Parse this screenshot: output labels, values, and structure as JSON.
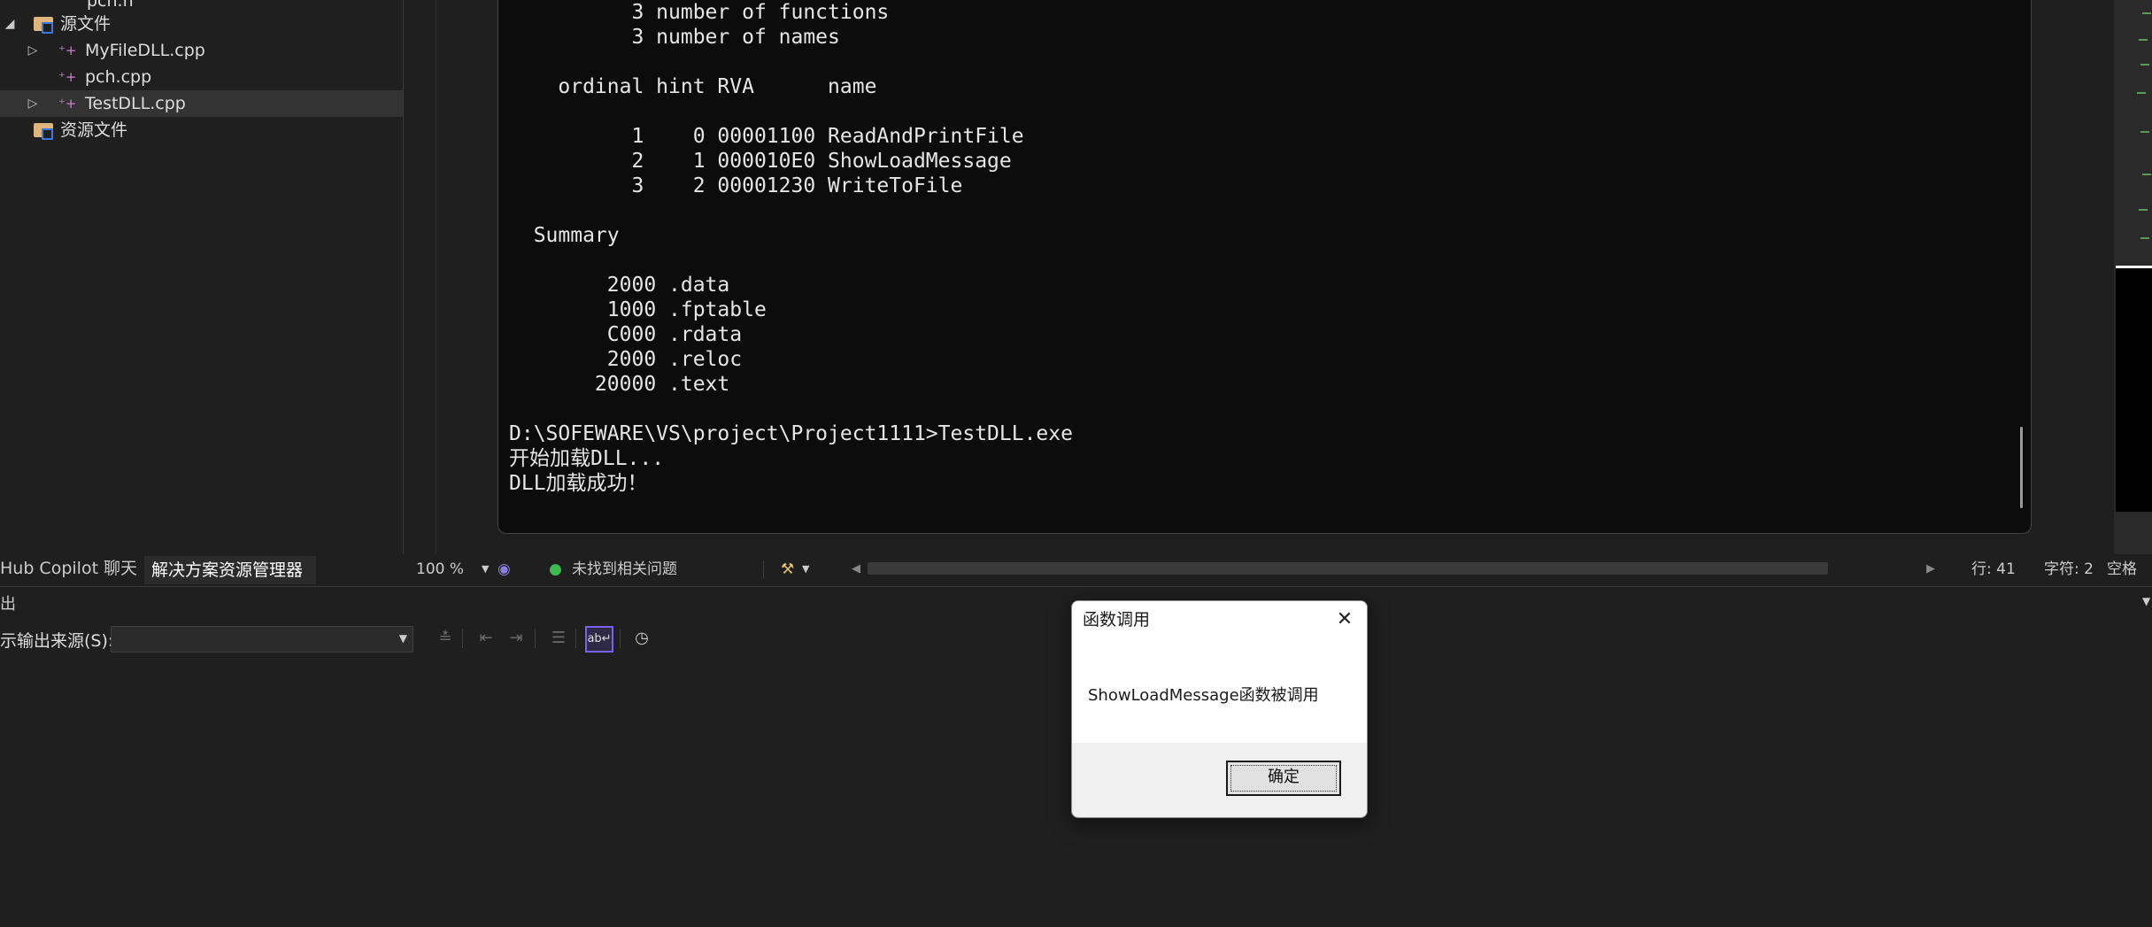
{
  "solution_explorer": {
    "items": [
      {
        "label": "pch.h",
        "type": "header"
      },
      {
        "label": "源文件",
        "type": "folder",
        "expanded": true
      },
      {
        "label": "MyFileDLL.cpp",
        "type": "cpp",
        "collapsed": true
      },
      {
        "label": "pch.cpp",
        "type": "cpp"
      },
      {
        "label": "TestDLL.cpp",
        "type": "cpp",
        "collapsed": true,
        "selected": true
      },
      {
        "label": "资源文件",
        "type": "folder"
      }
    ],
    "tabs": [
      "Hub Copilot 聊天",
      "解决方案资源管理器"
    ]
  },
  "console": {
    "lines": [
      "          3 number of functions",
      "          3 number of names",
      "",
      "    ordinal hint RVA      name",
      "",
      "          1    0 00001100 ReadAndPrintFile",
      "          2    1 000010E0 ShowLoadMessage",
      "          3    2 00001230 WriteToFile",
      "",
      "  Summary",
      "",
      "        2000 .data",
      "        1000 .fptable",
      "        C000 .rdata",
      "        2000 .reloc",
      "       20000 .text",
      "",
      "D:\\SOFEWARE\\VS\\project\\Project1111>TestDLL.exe",
      "开始加载DLL...",
      "DLL加载成功！"
    ]
  },
  "editor_status": {
    "zoom": "100 %",
    "issues": "未找到相关问题",
    "line": "行: 41",
    "char": "字符: 2",
    "whitespace": "空格"
  },
  "output": {
    "title": "出",
    "source_label": "示输出来源(S):",
    "source_value": ""
  },
  "message_box": {
    "title": "函数调用",
    "text": "ShowLoadMessage函数被调用",
    "ok_label": "确定"
  },
  "colors": {
    "background": "#1f1f1f",
    "console_bg": "#0c0c0c",
    "accent": "#7a5ff0",
    "ok_status": "#3fb950"
  }
}
